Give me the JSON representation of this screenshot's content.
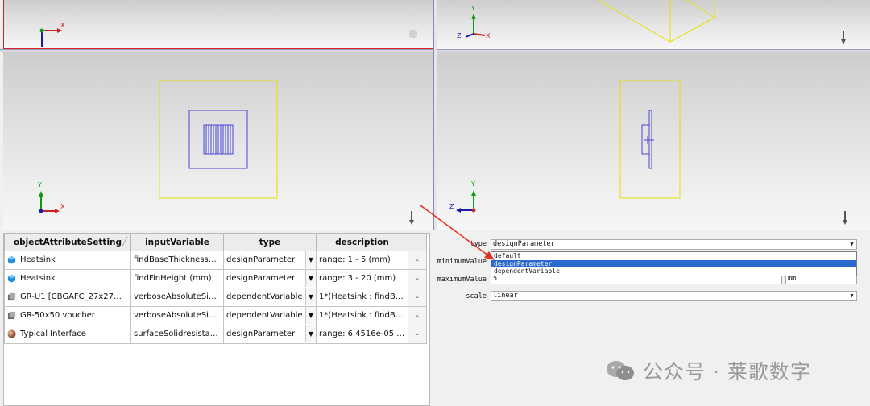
{
  "viewports": {
    "top_left": {
      "axis_y": "",
      "axis_x": "X"
    },
    "top_right": {
      "axis_y": "Y",
      "axis_x": "X",
      "axis_z": "Z"
    },
    "bottom_left": {
      "axis_y": "Y",
      "axis_x": "X"
    },
    "bottom_right": {
      "axis_y": "Y",
      "axis_z": "Z"
    }
  },
  "table": {
    "headers": [
      "objectAttributeSetting",
      "inputVariable",
      "type",
      "description"
    ],
    "sort_indicator": "╱",
    "rows": [
      {
        "object": "Heatsink",
        "icon": "blue-cube-icon",
        "input": "findBaseThicknessZo (...",
        "type": "designParameter",
        "description": "range: 1 - 5 (mm)",
        "extra": "-"
      },
      {
        "object": "Heatsink",
        "icon": "blue-cube-icon",
        "input": "findFinHeight (mm)",
        "type": "designParameter",
        "description": "range: 3 - 20 (mm)",
        "extra": "-"
      },
      {
        "object": "GR-U1 [CBGAFC_27x27mm_...",
        "icon": "component-icon",
        "input": "verboseAbsoluteSizeZ...",
        "type": "dependentVariable",
        "description": "1*(Heatsink : findBase...",
        "extra": "-"
      },
      {
        "object": "GR-50x50 voucher",
        "icon": "component-icon",
        "input": "verboseAbsoluteSizeZ...",
        "type": "dependentVariable",
        "description": "1*(Heatsink : findBase...",
        "extra": "-"
      },
      {
        "object": "Typical Interface",
        "icon": "sphere-icon",
        "input": "surfaceSolidresistance...",
        "type": "designParameter",
        "description": "range: 6.4516e-05 - 0....",
        "extra": "-"
      }
    ]
  },
  "properties": {
    "type_label": "type",
    "type_value": "designParameter",
    "minimum_label": "minimumValue",
    "maximum_label": "maximumValue",
    "maximum_value": "5",
    "maximum_unit": "mm",
    "scale_label": "scale",
    "scale_value": "linear",
    "type_options": [
      "default",
      "designParameter",
      "dependentVariable"
    ],
    "type_selected": "designParameter"
  },
  "watermark": {
    "text": "公众号 · 莱歌数字",
    "icon": "wechat-icon"
  },
  "colors": {
    "accent_red": "#e03020",
    "selection_blue": "#2a6acd",
    "model_yellow": "#e8e000",
    "model_blue": "#4848d8"
  }
}
